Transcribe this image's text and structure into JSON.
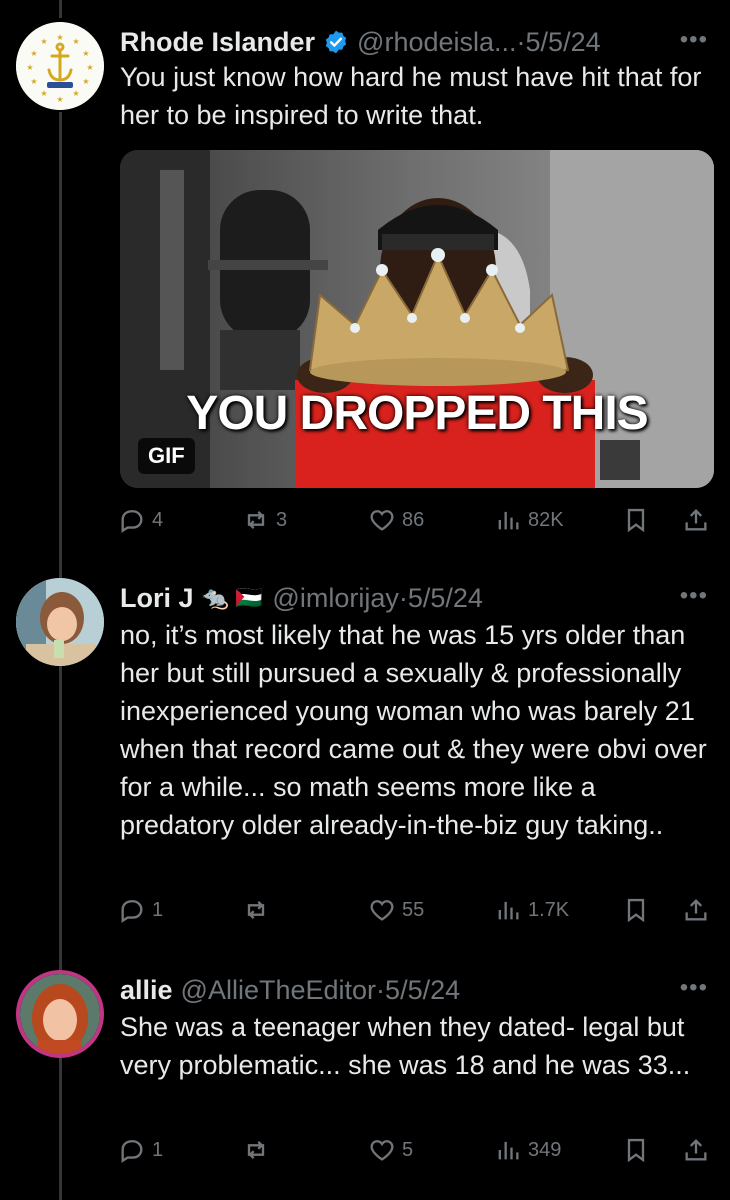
{
  "tweets": [
    {
      "name": "Rhode Islander",
      "verified": true,
      "handle": "@rhodeisla...",
      "date": "5/5/24",
      "text": "You just know how hard he must have hit that for her to be inspired to write that.",
      "media": {
        "caption": "YOU DROPPED THIS",
        "badge": "GIF"
      },
      "stats": {
        "replies": "4",
        "reposts": "3",
        "likes": "86",
        "views": "82K"
      }
    },
    {
      "name": "Lori J",
      "name_emojis": "🐀 🇵🇸",
      "handle": "@imlorijay",
      "date": "5/5/24",
      "text": "no, it’s most likely that he was 15 yrs older than her but still pursued a sexually & professionally inexperienced young woman who was barely 21 when that record came out & they were obvi over for a while... so math seems more like a predatory older already-in-the-biz guy taking..",
      "stats": {
        "replies": "1",
        "reposts": "",
        "likes": "55",
        "views": "1.7K"
      }
    },
    {
      "name": "allie",
      "handle": "@AllieTheEditor",
      "date": "5/5/24",
      "text": "She was a teenager when they dated- legal but very problematic... she was 18 and he was 33...",
      "stats": {
        "replies": "1",
        "reposts": "",
        "likes": "5",
        "views": "349"
      }
    }
  ],
  "colors": {
    "background": "#000000",
    "text": "#e7e9ea",
    "muted": "#71767b",
    "verified": "#1d9bf0"
  }
}
